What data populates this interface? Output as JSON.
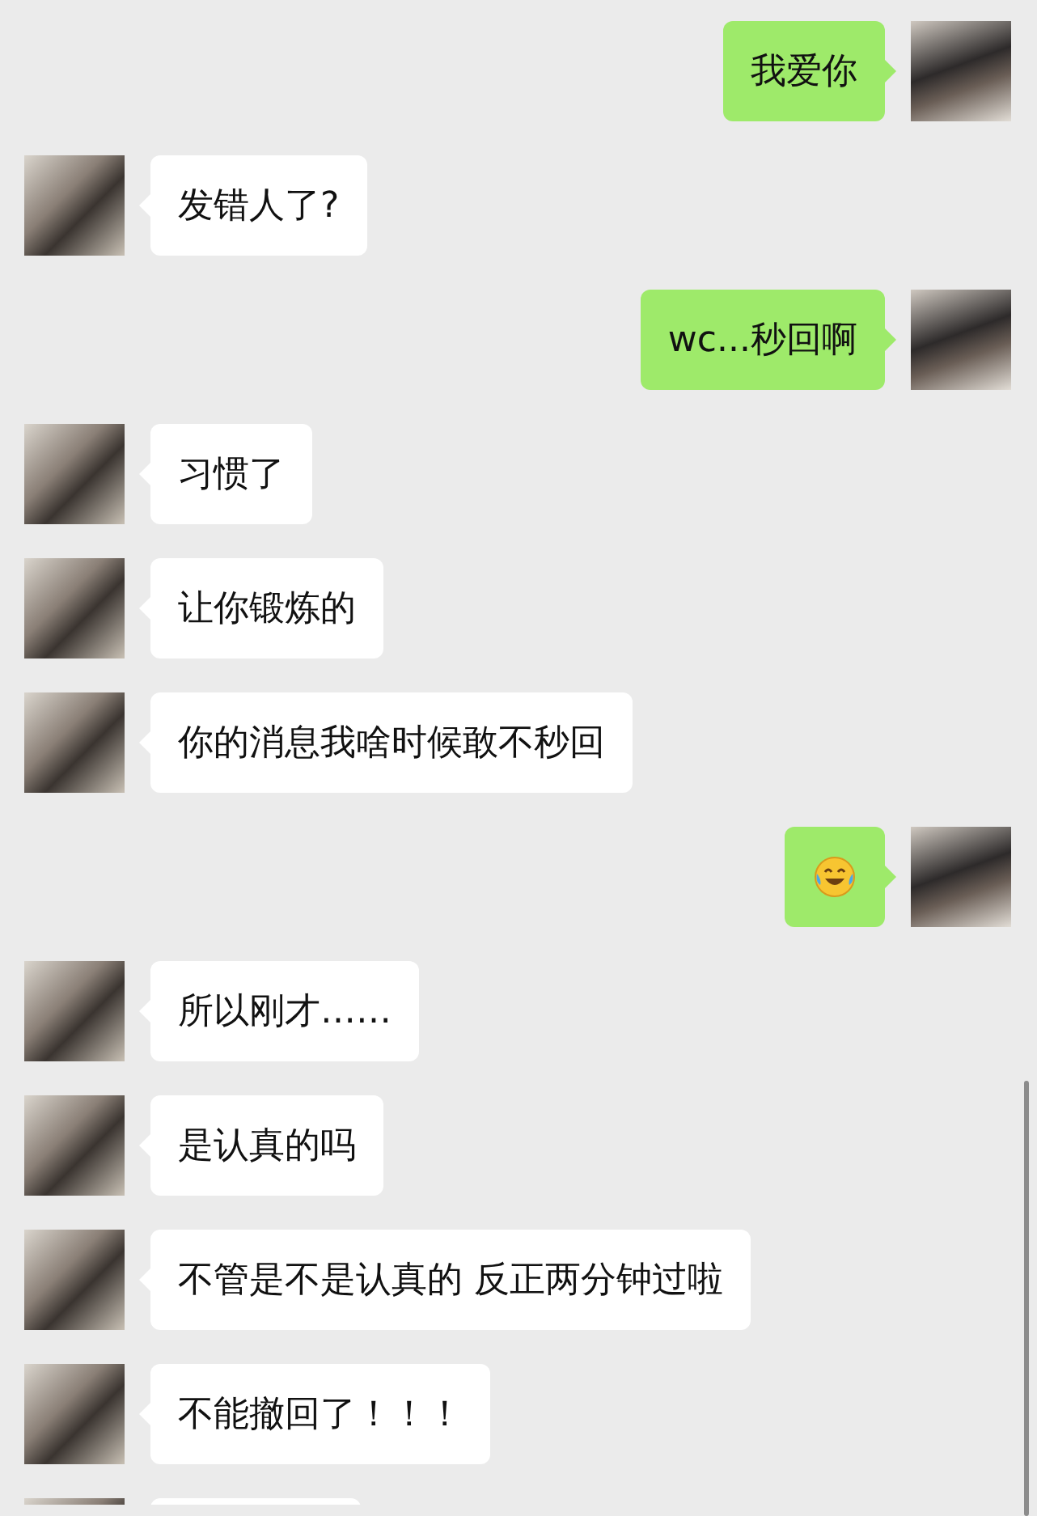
{
  "messages": [
    {
      "outgoing": true,
      "kind": "text",
      "text": "我爱你"
    },
    {
      "outgoing": false,
      "kind": "text",
      "text": "发错人了?"
    },
    {
      "outgoing": true,
      "kind": "text",
      "text": "wc...秒回啊"
    },
    {
      "outgoing": false,
      "kind": "text",
      "text": "习惯了"
    },
    {
      "outgoing": false,
      "kind": "text",
      "text": "让你锻炼的"
    },
    {
      "outgoing": false,
      "kind": "text",
      "text": "你的消息我啥时候敢不秒回"
    },
    {
      "outgoing": true,
      "kind": "emoji"
    },
    {
      "outgoing": false,
      "kind": "text",
      "text": "所以刚才……"
    },
    {
      "outgoing": false,
      "kind": "text",
      "text": "是认真的吗"
    },
    {
      "outgoing": false,
      "kind": "text",
      "text": "不管是不是认真的 反正两分钟过啦"
    },
    {
      "outgoing": false,
      "kind": "text",
      "text": "不能撤回了！！！"
    },
    {
      "outgoing": false,
      "kind": "cut"
    }
  ]
}
